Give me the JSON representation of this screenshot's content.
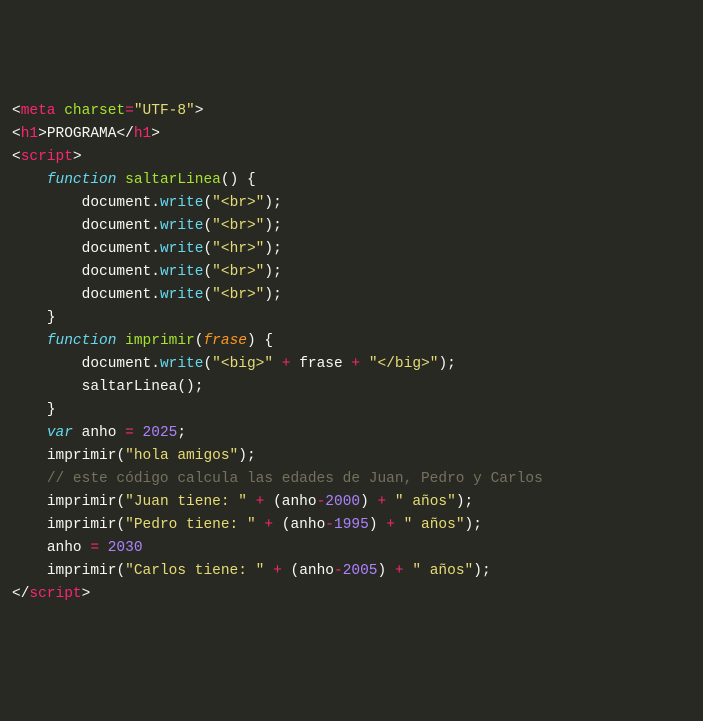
{
  "code": {
    "metaTag": "meta",
    "metaAttr": "charset",
    "metaVal": "\"UTF-8\"",
    "h1Open": "h1",
    "h1Text": "PROGRAMA",
    "h1Close": "h1",
    "scriptOpen": "script",
    "scriptClose": "script",
    "kwFunction": "function",
    "kwVar": "var",
    "fnSaltarLinea": "saltarLinea",
    "fnImprimir": "imprimir",
    "paramFrase": "frase",
    "objDocument": "document",
    "methodWrite": "write",
    "strBr": "\"<br>\"",
    "strHr": "\"<hr>\"",
    "strBigOpen": "\"<big>\"",
    "strBigClose": "\"</big>\"",
    "varFrase": "frase",
    "callSaltar": "saltarLinea",
    "varAnho": "anho",
    "num2025": "2025",
    "callImprimir": "imprimir",
    "strHola": "\"hola amigos\"",
    "comment": "// este código calcula las edades de Juan, Pedro y Carlos",
    "strJuan": "\"Juan tiene: \"",
    "strPedro": "\"Pedro tiene: \"",
    "strCarlos": "\"Carlos tiene: \"",
    "strAnos": "\" años\"",
    "num2000": "2000",
    "num1995": "1995",
    "num2005": "2005",
    "num2030": "2030",
    "plus": "+",
    "minus": "-",
    "eq": "=",
    "dot": ".",
    "semi": ";",
    "lt": "<",
    "gt": ">",
    "ltSlash": "</",
    "lparen": "(",
    "rparen": ")",
    "lbrace": "{",
    "rbrace": "}"
  }
}
